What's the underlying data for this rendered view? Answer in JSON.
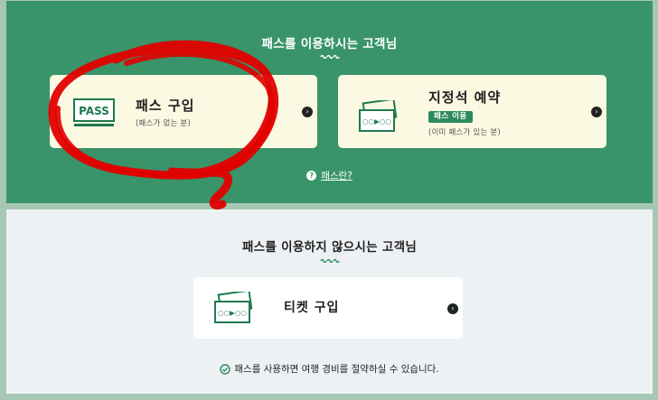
{
  "colors": {
    "primary_green": "#399469",
    "card_bg": "#fbf9e2",
    "annotation_red": "#e10000"
  },
  "pass_section": {
    "title": "패스를 이용하시는 고객님",
    "pass_card": {
      "icon": "pass-ticket-icon",
      "icon_text": "PASS",
      "title": "패스 구입",
      "subtitle": "(패스가 없는 분)"
    },
    "reserve_card": {
      "icon": "ticket-card-icon",
      "icon_text": "○○▶○○",
      "title": "지정석 예약",
      "badge": "패스 이용",
      "subtitle": "(이미 패스가 있는 분)"
    },
    "help_icon": "question-icon",
    "help_link": "패스란?"
  },
  "no_pass_section": {
    "title": "패스를 이용하지 않으시는 고객님",
    "ticket_card": {
      "icon": "ticket-card-icon",
      "icon_text": "○○▶○○",
      "title": "티켓 구입"
    },
    "note_icon": "check-circle-icon",
    "note": "패스를 사용하면 여행 경비를 절약하실 수 있습니다."
  }
}
